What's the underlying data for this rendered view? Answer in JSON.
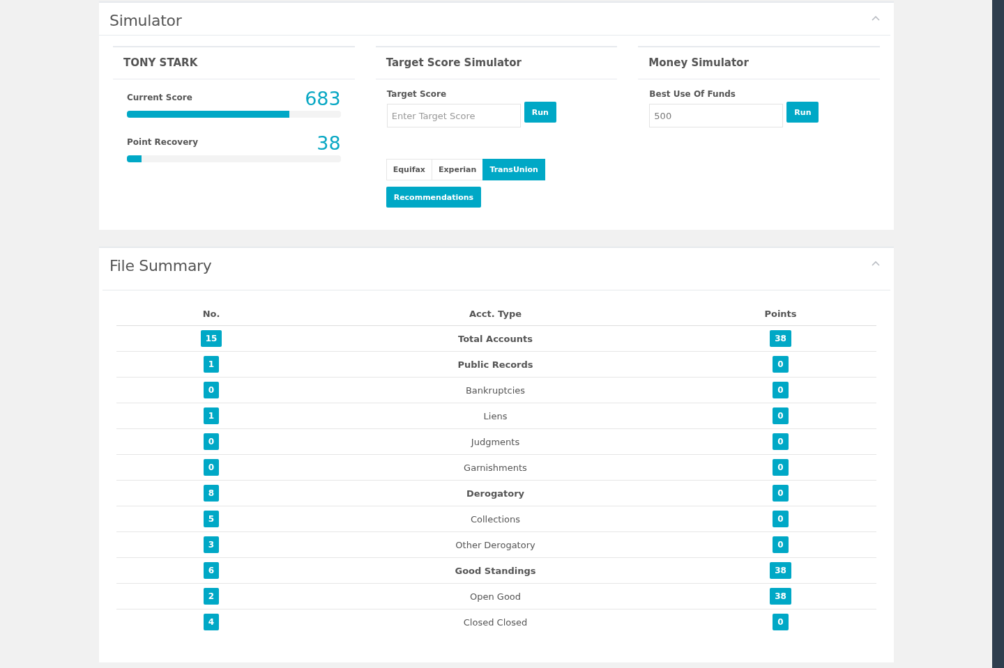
{
  "simulator": {
    "title": "Simulator",
    "expanded": true,
    "profile": {
      "name": "TONY STARK",
      "meters": [
        {
          "label": "Current Score",
          "reading": "683",
          "level": 0.76
        },
        {
          "label": "Point Recovery",
          "reading": "38",
          "level": 0.07
        }
      ]
    },
    "target": {
      "title": "Target Score Simulator",
      "label": "Target Score",
      "placeholder": "Enter Target Score",
      "button": "Run",
      "bureaus": [
        {
          "label": "Equifax",
          "selected": false
        },
        {
          "label": "Experian",
          "selected": false
        },
        {
          "label": "TransUnion",
          "selected": true
        }
      ],
      "recommendations": "Recommendations"
    },
    "money": {
      "title": "Money Simulator",
      "label": "Best Use Of Funds",
      "value": "500",
      "button": "Run"
    }
  },
  "file_summary": {
    "title": "File Summary",
    "expanded": true,
    "columns": [
      "No.",
      "Acct. Type",
      "Points"
    ],
    "rows": [
      {
        "no": "15",
        "type": "Total Accounts",
        "points": "38",
        "bold": true
      },
      {
        "no": "1",
        "type": "Public Records",
        "points": "0",
        "bold": true
      },
      {
        "no": "0",
        "type": "Bankruptcies",
        "points": "0",
        "bold": false
      },
      {
        "no": "1",
        "type": "Liens",
        "points": "0",
        "bold": false
      },
      {
        "no": "0",
        "type": "Judgments",
        "points": "0",
        "bold": false
      },
      {
        "no": "0",
        "type": "Garnishments",
        "points": "0",
        "bold": false
      },
      {
        "no": "8",
        "type": "Derogatory",
        "points": "0",
        "bold": true
      },
      {
        "no": "5",
        "type": "Collections",
        "points": "0",
        "bold": false
      },
      {
        "no": "3",
        "type": "Other Derogatory",
        "points": "0",
        "bold": false
      },
      {
        "no": "6",
        "type": "Good Standings",
        "points": "38",
        "bold": true
      },
      {
        "no": "2",
        "type": "Open Good",
        "points": "38",
        "bold": false
      },
      {
        "no": "4",
        "type": "Closed Closed",
        "points": "0",
        "bold": false
      }
    ]
  }
}
